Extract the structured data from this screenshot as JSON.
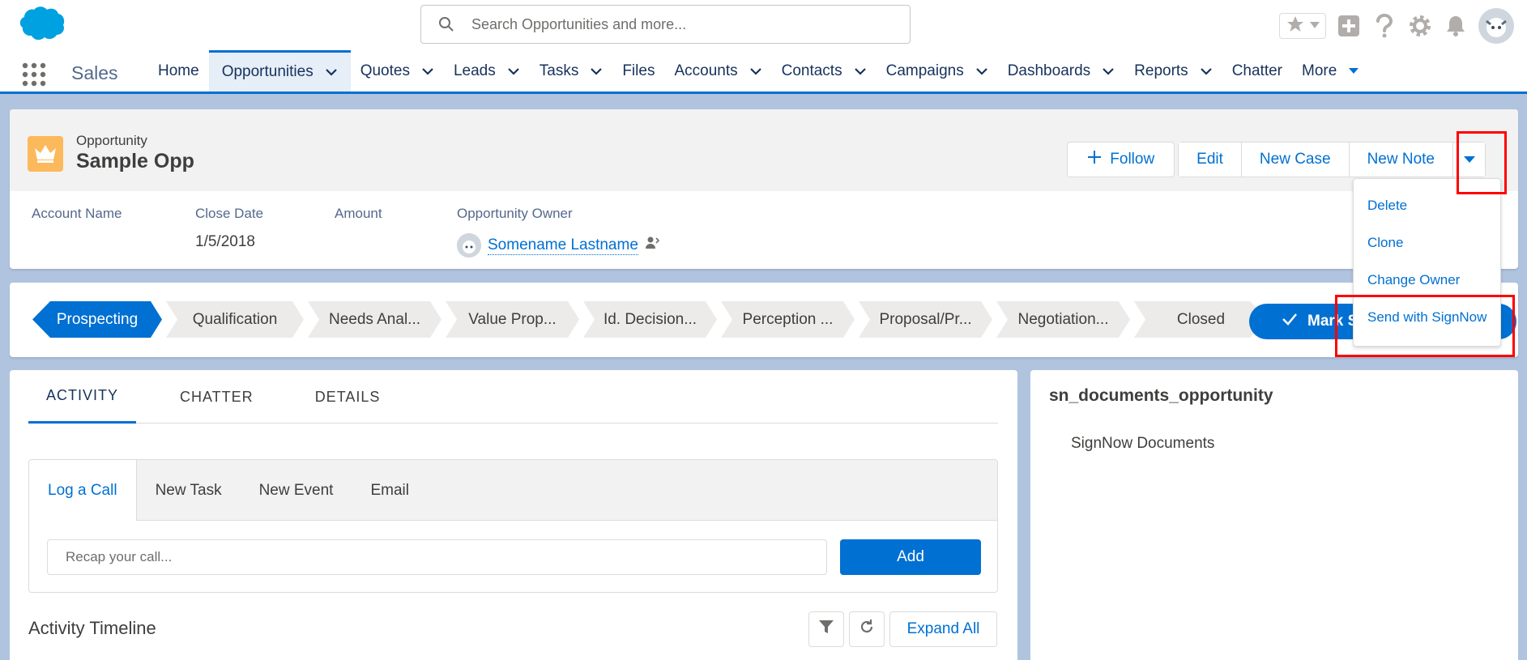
{
  "header": {
    "search_placeholder": "Search Opportunities and more..."
  },
  "nav": {
    "app_name": "Sales",
    "items": [
      {
        "label": "Home",
        "chevron": false,
        "active": false
      },
      {
        "label": "Opportunities",
        "chevron": true,
        "active": true
      },
      {
        "label": "Quotes",
        "chevron": true,
        "active": false
      },
      {
        "label": "Leads",
        "chevron": true,
        "active": false
      },
      {
        "label": "Tasks",
        "chevron": true,
        "active": false
      },
      {
        "label": "Files",
        "chevron": false,
        "active": false
      },
      {
        "label": "Accounts",
        "chevron": true,
        "active": false
      },
      {
        "label": "Contacts",
        "chevron": true,
        "active": false
      },
      {
        "label": "Campaigns",
        "chevron": true,
        "active": false
      },
      {
        "label": "Dashboards",
        "chevron": true,
        "active": false
      },
      {
        "label": "Reports",
        "chevron": true,
        "active": false
      },
      {
        "label": "Chatter",
        "chevron": false,
        "active": false
      },
      {
        "label": "More",
        "chevron": true,
        "active": false
      }
    ]
  },
  "record": {
    "type": "Opportunity",
    "title": "Sample Opp",
    "actions": {
      "follow": "Follow",
      "edit": "Edit",
      "new_case": "New Case",
      "new_note": "New Note"
    },
    "fields": {
      "account_name_label": "Account Name",
      "close_date_label": "Close Date",
      "close_date_value": "1/5/2018",
      "amount_label": "Amount",
      "owner_label": "Opportunity Owner",
      "owner_value": "Somename Lastname"
    }
  },
  "dropdown": {
    "items": [
      "Delete",
      "Clone",
      "Change Owner",
      "Send with SignNow"
    ]
  },
  "path": {
    "stages": [
      "Prospecting",
      "Qualification",
      "Needs Anal...",
      "Value Prop...",
      "Id. Decision...",
      "Perception ...",
      "Proposal/Pr...",
      "Negotiation...",
      "Closed"
    ],
    "current": "Prospecting",
    "mark_button": "Mark St"
  },
  "activity": {
    "tabs": [
      "ACTIVITY",
      "CHATTER",
      "DETAILS"
    ],
    "publisher_tabs": [
      "Log a Call",
      "New Task",
      "New Event",
      "Email"
    ],
    "recap_placeholder": "Recap your call...",
    "add_button": "Add",
    "timeline_title": "Activity Timeline",
    "expand_all": "Expand All"
  },
  "side": {
    "title": "sn_documents_opportunity",
    "item": "SignNow Documents"
  },
  "colors": {
    "brand": "#0070d2",
    "highlight": "#ff0000",
    "opportunity_icon": "#fcb95b"
  }
}
